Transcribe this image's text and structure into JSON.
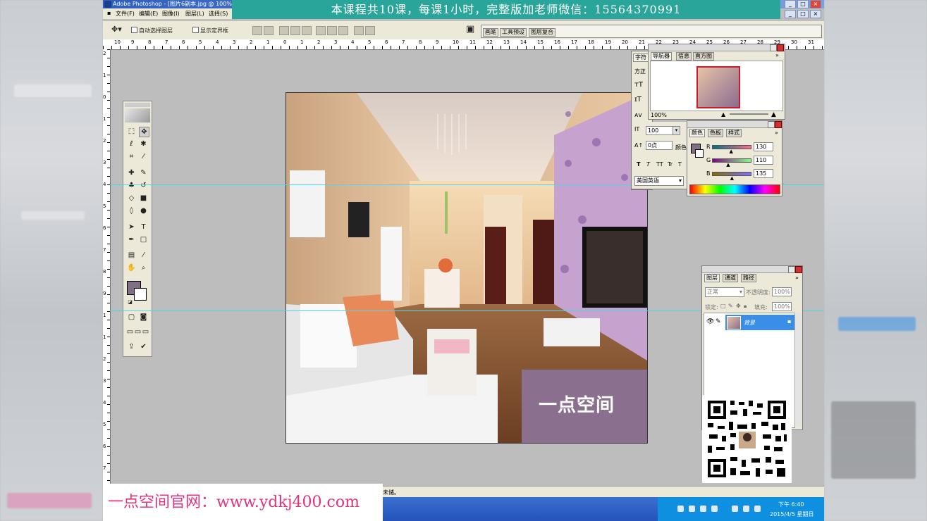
{
  "window": {
    "title": "Adobe Photoshop - [图片6副本.jpg @ 100%(R",
    "min": "_",
    "max": "□",
    "close": "×"
  },
  "banner": "本课程共10课，每课1小时，完整版加老师微信：15564370991",
  "menu": [
    "文件(F)",
    "编辑(E)",
    "图像(I)",
    "图层(L)",
    "选择(S)"
  ],
  "options": {
    "auto_select": "自动选择图层",
    "show_bounds": "显示定界框"
  },
  "palette_well": [
    "画笔",
    "工具预设",
    "图层复合"
  ],
  "ruler": {
    "top_ticks": [
      "10",
      "9",
      "8",
      "7",
      "6",
      "5",
      "4",
      "3",
      "2",
      "1",
      "0",
      "1",
      "2",
      "3",
      "4",
      "5",
      "6",
      "7",
      "8",
      "9",
      "10",
      "11",
      "12",
      "13",
      "14",
      "15",
      "16",
      "17",
      "18",
      "19",
      "20",
      "21",
      "22",
      "23",
      "24",
      "25",
      "26",
      "27",
      "28",
      "29",
      "30",
      "31"
    ],
    "left_ticks": [
      "2",
      "1",
      "0",
      "1",
      "2",
      "3",
      "4",
      "5",
      "6",
      "7",
      "8",
      "9",
      "1",
      "1",
      "2",
      "3",
      "4",
      "5",
      "6",
      "7"
    ]
  },
  "navigator": {
    "tabs": [
      "导航器",
      "信息",
      "直方图"
    ],
    "zoom": "100%"
  },
  "character": {
    "tab": "字符",
    "font": "方正",
    "size": "100",
    "tracking": "0点",
    "color_label": "颜色",
    "lang": "美国英语",
    "styles": [
      "T",
      "T",
      "TT",
      "Tr",
      "T"
    ]
  },
  "color": {
    "tabs": [
      "颜色",
      "色板",
      "样式"
    ],
    "r_label": "R",
    "g_label": "G",
    "b_label": "B",
    "r": 130,
    "g": 110,
    "b": 135,
    "swatch": "#826e87"
  },
  "layers": {
    "tabs": [
      "图层",
      "通道",
      "路径"
    ],
    "mode": "正常",
    "opacity_label": "不透明度:",
    "opacity": "100%",
    "lock_label": "锁定:",
    "fill_label": "填充:",
    "fill": "100%",
    "layer_name": "背景"
  },
  "canvas": {
    "caption": "一点空间"
  },
  "status": "未储。",
  "taskbar": {
    "time": "下午 6:40",
    "date": "2015/4/5 星期日"
  },
  "website": "一点空间官网：www.ydkj400.com",
  "colors": {
    "banner": "#2aa59a",
    "caption_bg": "#8a6f8e",
    "layer_selected": "#3a8ee6",
    "website_text": "#e0327f"
  }
}
